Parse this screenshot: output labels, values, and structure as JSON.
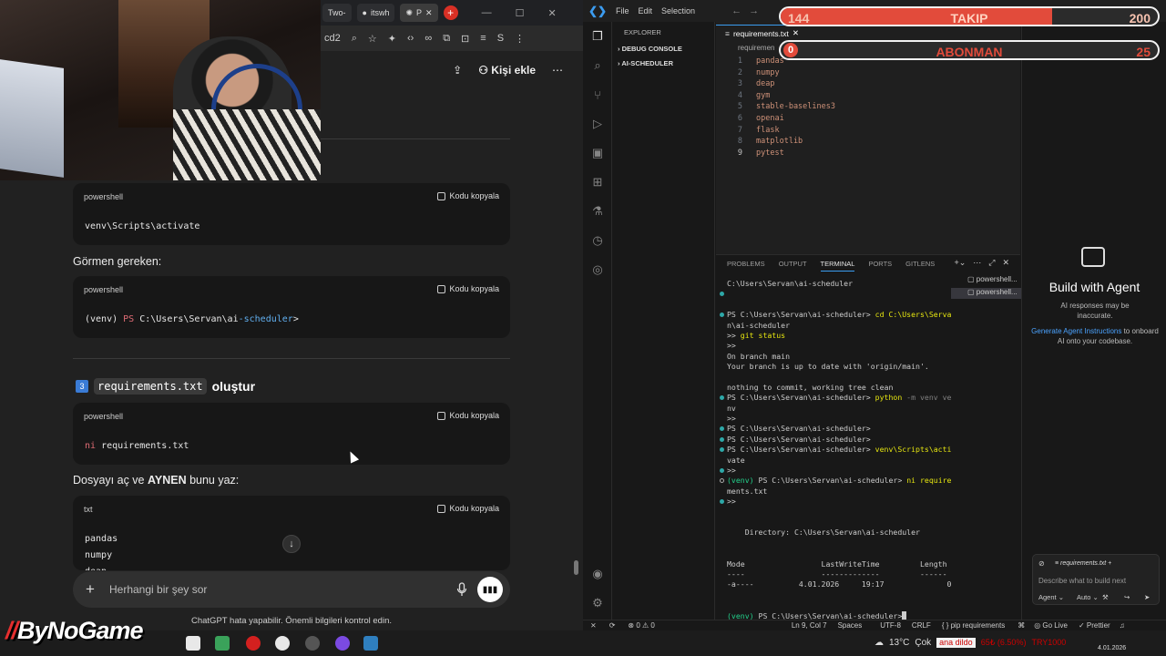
{
  "browser": {
    "tabs": [
      {
        "label": "Two-"
      },
      {
        "label": "itswh"
      },
      {
        "label": "P"
      }
    ],
    "toolbar_url_fragment": "cd2",
    "header": {
      "add_person_label": "Kişi ekle"
    }
  },
  "chat": {
    "blocks": [
      {
        "lang": "powershell",
        "copy": "Kodu kopyala",
        "code": "venv\\Scripts\\activate"
      },
      {
        "lang": "powershell",
        "copy": "Kodu kopyala",
        "code_prefix": "(venv) ",
        "code_ps": "PS ",
        "code_path1": "C:\\Users\\Servan\\ai",
        "code_path2": "-scheduler",
        "code_suffix": ">"
      },
      {
        "lang": "powershell",
        "copy": "Kodu kopyala",
        "code_kw": "ni",
        "code_rest": " requirements.txt"
      },
      {
        "lang": "txt",
        "copy": "Kodu kopyala",
        "lines": [
          "pandas",
          "numpy",
          "deap"
        ]
      }
    ],
    "see_label": "Görmen gereken:",
    "step3": {
      "num": "3",
      "code": "requirements.txt",
      "title": "oluştur"
    },
    "open_text_pre": "Dosyayı aç ve ",
    "open_text_bold": "AYNEN",
    "open_text_post": " bunu yaz:",
    "composer_placeholder": "Herhangi bir şey sor",
    "disclaimer": "ChatGPT hata yapabilir. Önemli bilgileri kontrol edin."
  },
  "vscode": {
    "menu": [
      "File",
      "Edit",
      "Selection"
    ],
    "sidebar_title": "EXPLORER",
    "sections": [
      "DEBUG CONSOLE",
      "AI-SCHEDULER"
    ],
    "editor_tab": "requirements.txt",
    "editor_crumb": "requiremen",
    "lines": [
      "pandas",
      "numpy",
      "deap",
      "gym",
      "stable-baselines3",
      "openai",
      "flask",
      "matplotlib",
      "pytest"
    ],
    "line_numbers": [
      "1",
      "2",
      "3",
      "4",
      "5",
      "6",
      "7",
      "8",
      "9"
    ],
    "panel_tabs": [
      "PROBLEMS",
      "OUTPUT",
      "TERMINAL",
      "PORTS",
      "GITLENS"
    ],
    "terminal_list": [
      "powershell...",
      "powershell..."
    ],
    "terminal": {
      "t01": "C:\\Users\\Servan\\ai-scheduler",
      "t02": "PS C:\\Users\\Servan\\ai-scheduler> ",
      "t02b": "cd C:\\Users\\Serva",
      "t03": "n\\ai-scheduler",
      "t04a": ">> ",
      "t04b": "git status",
      "t05": ">>",
      "t06": "On branch main",
      "t07": "Your branch is up to date with 'origin/main'.",
      "t08": "nothing to commit, working tree clean",
      "t09a": "PS C:\\Users\\Servan\\ai-scheduler> ",
      "t09b": "python",
      "t09c": " -m venv ve",
      "t10": "nv",
      "t11": ">>",
      "t12": "PS C:\\Users\\Servan\\ai-scheduler>",
      "t13": "PS C:\\Users\\Servan\\ai-scheduler>",
      "t14a": "PS C:\\Users\\Servan\\ai-scheduler> ",
      "t14b": "venv\\Scripts\\acti",
      "t15": "vate",
      "t16": ">>",
      "t17a": "(venv) ",
      "t17b": "PS C:\\Users\\Servan\\ai-scheduler> ",
      "t17c": "ni require",
      "t18": "ments.txt",
      "t19": ">>",
      "t20": "    Directory: C:\\Users\\Servan\\ai-scheduler",
      "t21": "Mode                 LastWriteTime         Length",
      "t22": "----                 -------------         ------",
      "t23": "-a----          4.01.2026     19:17              0",
      "t24a": "(venv) ",
      "t24b": "PS C:\\Users\\Servan\\ai-scheduler>"
    },
    "status": {
      "errors": "⊗ 0 ⚠ 0",
      "position": "Ln 9, Col 7",
      "spaces": "Spaces",
      "encoding": "UTF-8",
      "eol": "CRLF",
      "lang": "{ } pip requirements",
      "golive": "Go Live",
      "prettier": "Prettier"
    },
    "agent": {
      "title": "Build with Agent",
      "warning": "AI responses may be inaccurate.",
      "help_link": "Generate Agent Instructions",
      "help_rest": " to onboard AI onto your codebase.",
      "context": "requirements.txt",
      "placeholder": "Describe what to build next",
      "mode": "Agent",
      "model": "Auto"
    }
  },
  "overlay": {
    "follow": {
      "current": "144",
      "label": "TAKIP",
      "goal": "200",
      "progress": 0.72
    },
    "sub": {
      "current": "0",
      "label": "ABONMAN",
      "goal": "25",
      "progress": 0.0
    }
  },
  "taskbar": {
    "brand_mark": "//",
    "brand": "ByNoGame",
    "weather": "13°C",
    "weather_desc": "Çok",
    "news": "ana dildo",
    "ticker": "65₺ (6.50%)",
    "currency": "TRY1000",
    "date": "4.01.2026"
  },
  "colors": {
    "accent": "#3b9cf0",
    "overlay_bar": "#e24b3b",
    "chat_bg": "#212121",
    "editor_string": "#ce9178"
  }
}
